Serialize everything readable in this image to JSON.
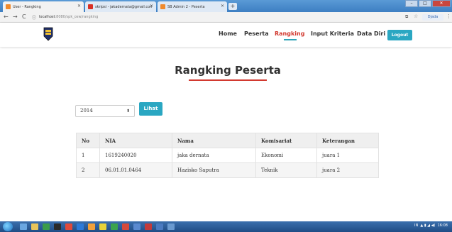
{
  "browser": {
    "tabs": [
      {
        "title": "User - Rangking",
        "active": true,
        "icon_color": "#f08a2c"
      },
      {
        "title": "skripsi - jakadernata@gmail.com",
        "active": false,
        "icon_color": "#d93025"
      },
      {
        "title": "SB Admin 2 - Peserta",
        "active": false,
        "icon_color": "#f08a2c"
      }
    ],
    "url_host": "localhost",
    "url_path": ":8080/spk_osw/rangking",
    "profile": "Djada"
  },
  "navbar": {
    "links": [
      "Home",
      "Peserta",
      "Rangking",
      "Input Kriteria",
      "Data Diri"
    ],
    "active": "Rangking",
    "logout": "Logout"
  },
  "page": {
    "title": "Rangking Peserta",
    "year_select": "2014",
    "lihat_label": "Lihat"
  },
  "table": {
    "headers": [
      "No",
      "NIA",
      "Nama",
      "Komisariat",
      "Keterangan"
    ],
    "rows": [
      [
        "1",
        "1619240020",
        "jaka dernata",
        "Ekonomi",
        "juara 1"
      ],
      [
        "2",
        "06.01.01.0464",
        "Hazisko Saputra",
        "Teknik",
        "juara 2"
      ]
    ]
  },
  "taskbar": {
    "clock": "16:08",
    "tray": "IN"
  },
  "colors": {
    "accent": "#2aa7c2",
    "active_link": "#d2392f"
  }
}
